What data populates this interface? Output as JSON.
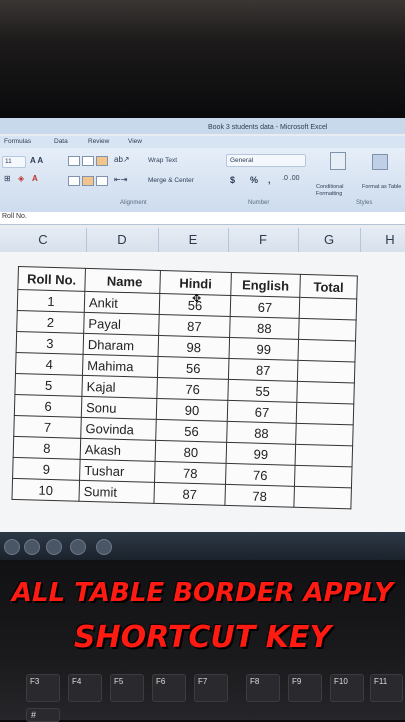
{
  "window": {
    "title": "Book 3 students data - Microsoft Excel",
    "tabs": [
      "Formulas",
      "Data",
      "Review",
      "View"
    ]
  },
  "ribbon": {
    "font_size": "11",
    "wrap_text": "Wrap Text",
    "merge_center": "Merge & Center",
    "number_format": "General",
    "alignment_label": "Alignment",
    "number_label": "Number",
    "styles_label": "Styles",
    "conditional_formatting": "Conditional Formatting",
    "format_as_table": "Format as Table",
    "currency": "$",
    "percent": "%",
    "comma": ","
  },
  "formula_bar": {
    "name_box": "Roll No."
  },
  "columns": [
    "C",
    "D",
    "E",
    "F",
    "G",
    "H"
  ],
  "table": {
    "headers": [
      "Roll No.",
      "Name",
      "Hindi",
      "English",
      "Total"
    ],
    "rows": [
      [
        "1",
        "Ankit",
        "56",
        "67",
        ""
      ],
      [
        "2",
        "Payal",
        "87",
        "88",
        ""
      ],
      [
        "3",
        "Dharam",
        "98",
        "99",
        ""
      ],
      [
        "4",
        "Mahima",
        "56",
        "87",
        ""
      ],
      [
        "5",
        "Kajal",
        "76",
        "55",
        ""
      ],
      [
        "6",
        "Sonu",
        "90",
        "67",
        ""
      ],
      [
        "7",
        "Govinda",
        "56",
        "88",
        ""
      ],
      [
        "8",
        "Akash",
        "80",
        "99",
        ""
      ],
      [
        "9",
        "Tushar",
        "78",
        "76",
        ""
      ],
      [
        "10",
        "Sumit",
        "87",
        "78",
        ""
      ]
    ]
  },
  "caption": {
    "line1": "ALL TABLE BORDER APPLY",
    "line2": "SHORTCUT KEY"
  },
  "keyboard": {
    "fkeys": [
      "F3",
      "F4",
      "F5",
      "F6",
      "F7",
      "F8",
      "F9",
      "F10",
      "F11"
    ],
    "row2": [
      "#"
    ]
  },
  "colors": {
    "caption": "#ff1a12",
    "ribbon": "#dde7f3"
  }
}
